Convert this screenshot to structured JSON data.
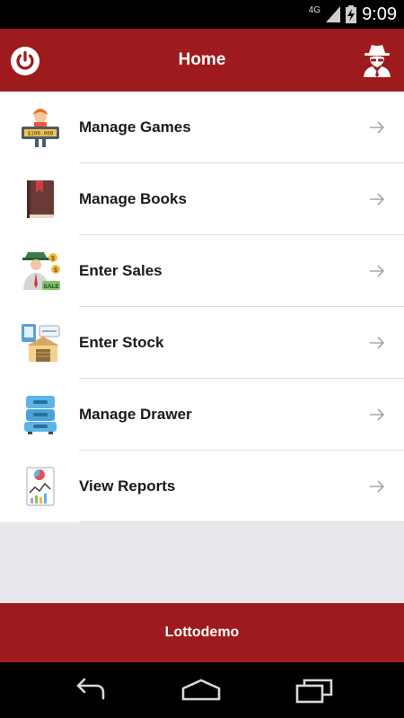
{
  "status_bar": {
    "network": "4G",
    "time": "9:09",
    "icons": [
      "signal-icon",
      "battery-charging-icon"
    ]
  },
  "header": {
    "title": "Home",
    "left_icon": "power-icon",
    "right_icon": "spy-icon",
    "background": "#9e1a1d"
  },
  "menu": {
    "items": [
      {
        "label": "Manage Games",
        "icon": "lottery-ticket-icon"
      },
      {
        "label": "Manage Books",
        "icon": "book-icon"
      },
      {
        "label": "Enter Sales",
        "icon": "salesman-icon"
      },
      {
        "label": "Enter Stock",
        "icon": "warehouse-icon"
      },
      {
        "label": "Manage Drawer",
        "icon": "drawer-cabinet-icon"
      },
      {
        "label": "View Reports",
        "icon": "report-chart-icon"
      }
    ],
    "trailing_icon": "arrow-right-icon"
  },
  "footer": {
    "label": "Lottodemo",
    "background": "#9e1a1d"
  },
  "navigation_bar": {
    "icons": [
      "back-icon",
      "home-icon",
      "recents-icon"
    ]
  }
}
